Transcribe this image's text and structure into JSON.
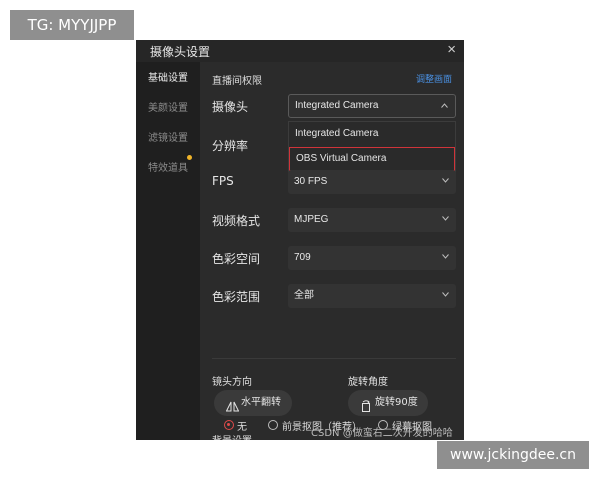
{
  "watermarks": {
    "top": "TG: MYYJJPP",
    "bottom": "www.jckingdee.cn",
    "csdn": "CSDN @做蛮右二次开发的哈哈"
  },
  "window": {
    "title": "摄像头设置",
    "close_icon": "close-icon"
  },
  "sidebar": {
    "items": [
      {
        "label": "基础设置",
        "active": true
      },
      {
        "label": "美颜设置",
        "active": false
      },
      {
        "label": "滤镜设置",
        "active": false
      },
      {
        "label": "特效道具",
        "active": false
      }
    ]
  },
  "main": {
    "section_title": "直播间权限",
    "adjust_link": "调整画面",
    "rows": {
      "camera": {
        "label": "摄像头",
        "value": "Integrated Camera"
      },
      "resolution": {
        "label": "分辨率"
      },
      "fps": {
        "label": "FPS",
        "value": "30 FPS"
      },
      "video_format": {
        "label": "视频格式",
        "value": "MJPEG"
      },
      "color_space": {
        "label": "色彩空间",
        "value": "709"
      },
      "color_range": {
        "label": "色彩范围",
        "value": "全部"
      }
    },
    "camera_dropdown": {
      "options": [
        "Integrated Camera",
        "OBS Virtual Camera"
      ],
      "highlighted": "OBS Virtual Camera"
    },
    "lens": {
      "label": "镜头方向",
      "button": "水平翻转"
    },
    "rotation": {
      "label": "旋转角度",
      "button": "旋转90度"
    },
    "background": {
      "label": "背景设置",
      "options": [
        {
          "label": "无",
          "selected": true
        },
        {
          "label": "前景抠图（推荐）",
          "selected": false
        },
        {
          "label": "绿幕抠图",
          "selected": false
        }
      ]
    }
  },
  "colors": {
    "accent_link": "#4a90e2",
    "highlight_border": "#d0343a",
    "radio_selected": "#e04a4a",
    "notification_dot": "#f0b429"
  }
}
